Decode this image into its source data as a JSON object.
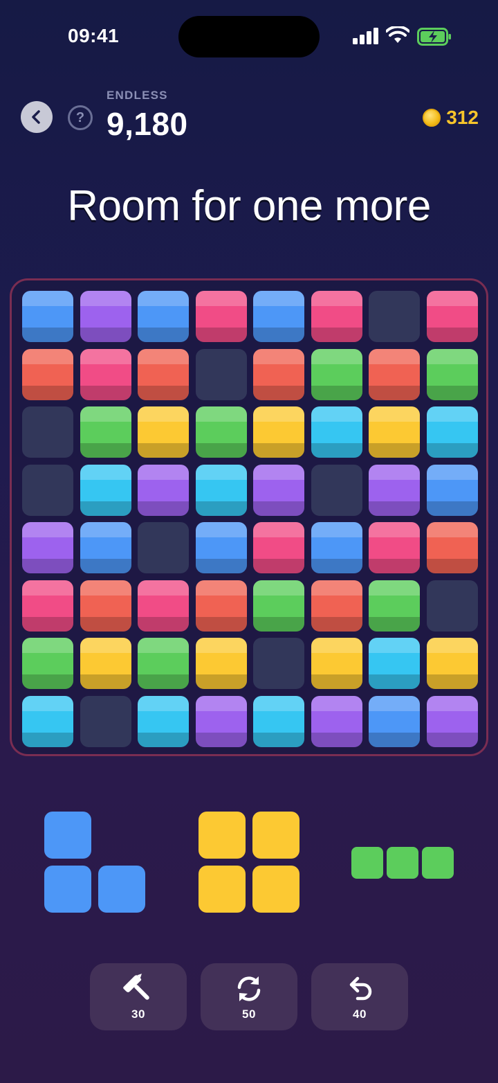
{
  "status_bar": {
    "time": "09:41"
  },
  "header": {
    "mode_label": "ENDLESS",
    "score": "9,180",
    "coins": "312",
    "help_glyph": "?"
  },
  "message": "Room for one more",
  "colors": {
    "blue": "#4d97f7",
    "purple": "#9d62ee",
    "pink": "#f14c86",
    "red": "#f06253",
    "green": "#5ccd5c",
    "yellow": "#fcc933",
    "cyan": "#36c6f2",
    "empty": "#32375a",
    "board_border": "#7a2d52",
    "coin": "#f7c52b"
  },
  "board": {
    "rows": 8,
    "cols": 8,
    "cells": [
      [
        "blue",
        "purple",
        "blue",
        "pink",
        "blue",
        "pink",
        "empty",
        "pink"
      ],
      [
        "red",
        "pink",
        "red",
        "empty",
        "red",
        "green",
        "red",
        "green"
      ],
      [
        "empty",
        "green",
        "yellow",
        "green",
        "yellow",
        "cyan",
        "yellow",
        "cyan"
      ],
      [
        "empty",
        "cyan",
        "purple",
        "cyan",
        "purple",
        "empty",
        "purple",
        "blue"
      ],
      [
        "purple",
        "blue",
        "empty",
        "blue",
        "pink",
        "blue",
        "pink",
        "red"
      ],
      [
        "pink",
        "red",
        "pink",
        "red",
        "green",
        "red",
        "green",
        "empty"
      ],
      [
        "green",
        "yellow",
        "green",
        "yellow",
        "empty",
        "yellow",
        "cyan",
        "yellow"
      ],
      [
        "cyan",
        "empty",
        "cyan",
        "purple",
        "cyan",
        "purple",
        "blue",
        "purple"
      ]
    ]
  },
  "pieces": [
    {
      "name": "L-piece",
      "color": "blue",
      "shape": [
        [
          1,
          0
        ],
        [
          1,
          1
        ]
      ]
    },
    {
      "name": "square-piece",
      "color": "yellow",
      "shape": [
        [
          1,
          1
        ],
        [
          1,
          1
        ]
      ]
    },
    {
      "name": "line-piece",
      "color": "green",
      "shape": [
        [
          1,
          1,
          1
        ]
      ]
    }
  ],
  "powerups": [
    {
      "name": "hammer",
      "icon": "hammer-icon",
      "count": "30"
    },
    {
      "name": "shuffle",
      "icon": "refresh-icon",
      "count": "50"
    },
    {
      "name": "undo",
      "icon": "undo-icon",
      "count": "40"
    }
  ]
}
